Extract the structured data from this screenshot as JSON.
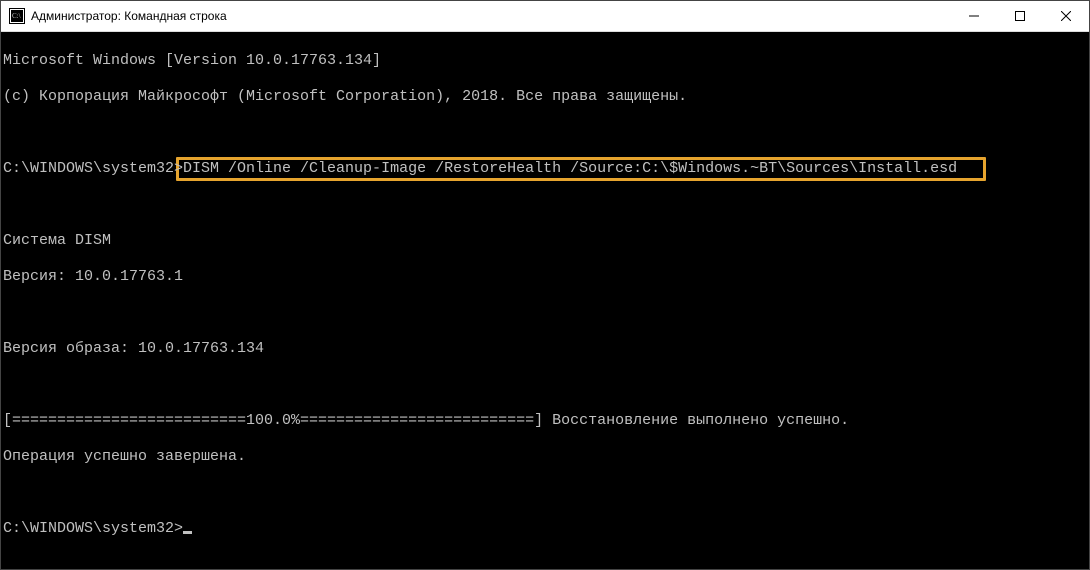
{
  "window": {
    "title": "Администратор: Командная строка"
  },
  "console": {
    "line1": "Microsoft Windows [Version 10.0.17763.134]",
    "line2": "(c) Корпорация Майкрософт (Microsoft Corporation), 2018. Все права защищены.",
    "blank": " ",
    "prompt1_path": "C:\\WINDOWS\\system32>",
    "prompt1_cmd": "DISM /Online /Cleanup-Image /RestoreHealth /Source:C:\\$Windows.~BT\\Sources\\Install.esd",
    "dism_label": "Cистема DISM",
    "dism_ver": "Версия: 10.0.17763.1",
    "image_ver": "Версия образа: 10.0.17763.134",
    "progress": "[==========================100.0%==========================] Восстановление выполнено успешно.",
    "done": "Операция успешно завершена.",
    "prompt2": "C:\\WINDOWS\\system32>"
  }
}
